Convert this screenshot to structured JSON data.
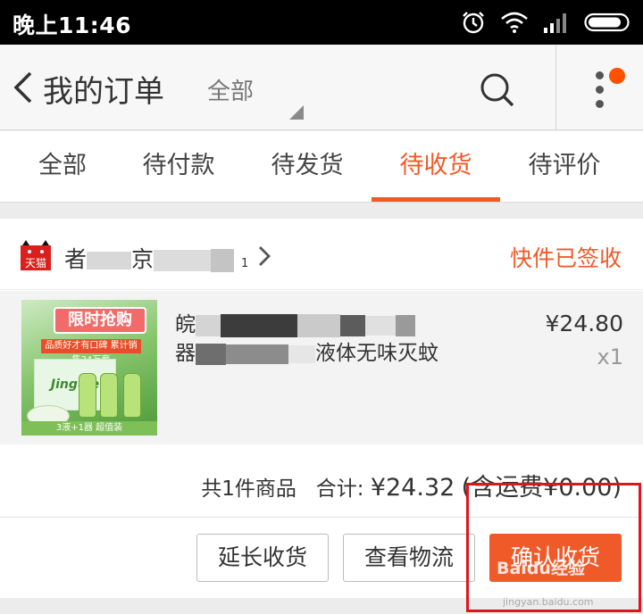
{
  "status_bar": {
    "time": "晚上11:46",
    "icons": [
      "alarm-icon",
      "wifi-icon",
      "signal-icon",
      "battery-icon"
    ]
  },
  "header": {
    "back_icon": "chevron-left-icon",
    "title": "我的订单",
    "filter": "全部",
    "search_icon": "search-icon",
    "more_icon": "more-vertical-icon",
    "has_notification": true
  },
  "tabs": [
    {
      "label": "全部",
      "active": false
    },
    {
      "label": "待付款",
      "active": false
    },
    {
      "label": "待发货",
      "active": false
    },
    {
      "label": "待收货",
      "active": true
    },
    {
      "label": "待评价",
      "active": false
    }
  ],
  "order": {
    "shop_logo": "天猫",
    "shop_name_visible": [
      "者",
      "京",
      "1"
    ],
    "status": "快件已签收",
    "product": {
      "image_text": {
        "banner": "限时抢购",
        "sub": "品质好才有口碑 累计销售24万套",
        "box": "Jinguie",
        "strip": "3液+1器 超值装"
      },
      "title_line1": "皖",
      "title_line2_start": "器",
      "title_line2_end": "液体无味灭蚊",
      "price": "¥24.80",
      "quantity": "x1"
    },
    "summary": {
      "count_text": "共1件商品",
      "total_label": "合计:",
      "total": "¥24.32",
      "shipping": "(含运费¥0.00)"
    },
    "actions": {
      "extend": "延长收货",
      "logistics": "查看物流",
      "confirm": "确认收货"
    }
  },
  "watermark": {
    "text": "Baidu经验",
    "url": "jingyan.baidu.com"
  },
  "colors": {
    "accent": "#f05a28",
    "highlight": "#e0141e",
    "tmall_red": "#d9201c"
  }
}
